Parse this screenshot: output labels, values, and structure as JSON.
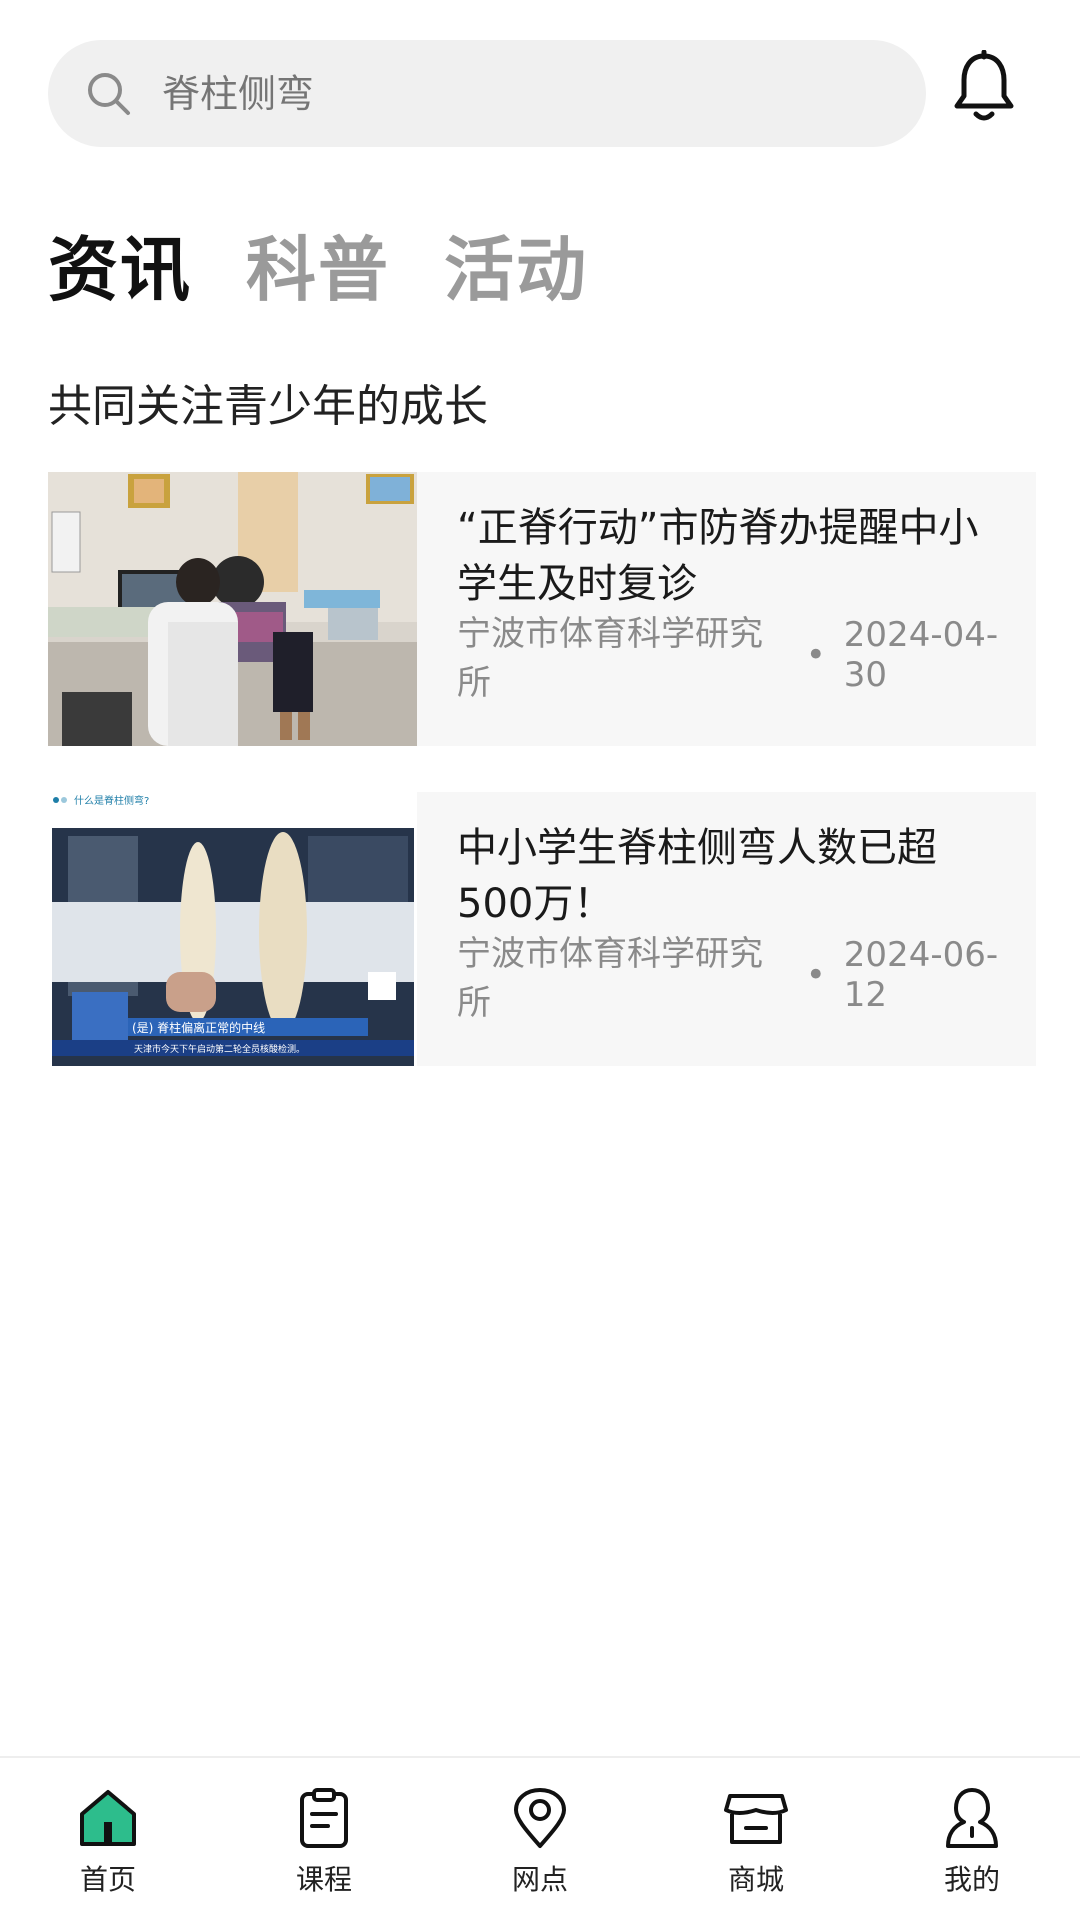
{
  "search": {
    "placeholder": "脊柱侧弯"
  },
  "tabs": [
    {
      "label": "资讯",
      "active": true
    },
    {
      "label": "科普",
      "active": false
    },
    {
      "label": "活动",
      "active": false
    }
  ],
  "section_title": "共同关注青少年的成长",
  "articles": [
    {
      "title": "“正脊行动”市防脊办提醒中小学生及时复诊",
      "source": "宁波市体育科学研究所",
      "separator": "•",
      "date": "2024-04-30",
      "thumb_desc": "clinic-photo"
    },
    {
      "title": "中小学生脊柱侧弯人数已超500万！",
      "source": "宁波市体育科学研究所",
      "separator": "•",
      "date": "2024-06-12",
      "thumb_desc": "news-broadcast-photo",
      "thumb_text": {
        "top": "什么是脊柱侧弯?",
        "caption": "(是) 脊柱偏离正常的中线",
        "ticker": "天津市今天下午启动第二轮全员核酸检测。"
      }
    }
  ],
  "bottom_nav": [
    {
      "label": "首页",
      "icon": "home-icon",
      "active": true
    },
    {
      "label": "课程",
      "icon": "clipboard-icon",
      "active": false
    },
    {
      "label": "网点",
      "icon": "location-pin-icon",
      "active": false
    },
    {
      "label": "商城",
      "icon": "store-icon",
      "active": false
    },
    {
      "label": "我的",
      "icon": "user-icon",
      "active": false
    }
  ],
  "colors": {
    "accent": "#2dbd8c",
    "text_primary": "#1a1a1a",
    "text_muted": "#8a8a8a",
    "search_bg": "#f0f0f0",
    "card_bg": "#f7f7f7"
  }
}
